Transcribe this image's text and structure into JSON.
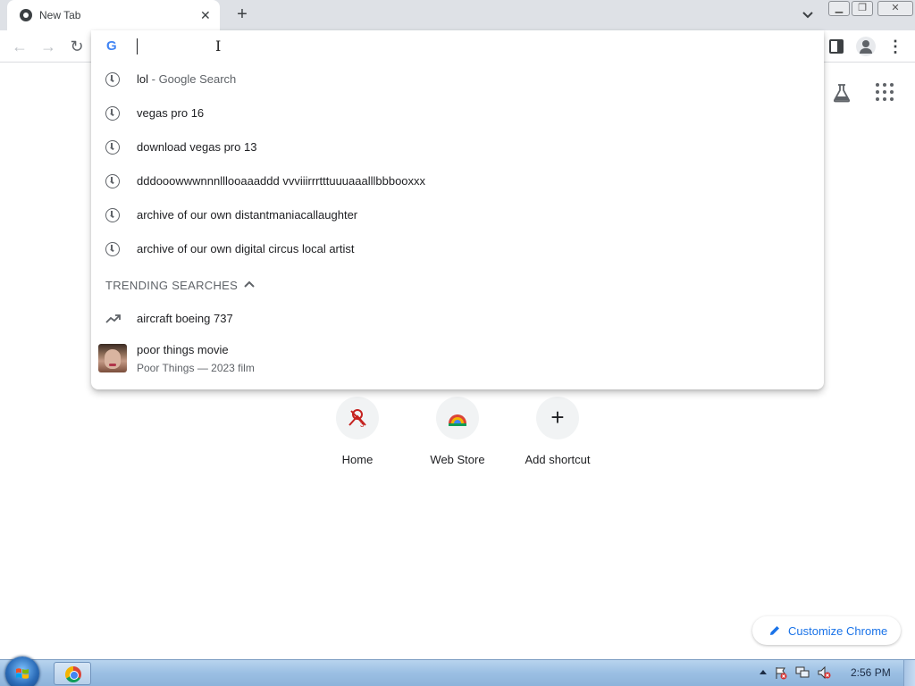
{
  "browser": {
    "tab_title": "New Tab",
    "new_tab_symbol": "+",
    "close_symbol": "✕"
  },
  "toolbar": {
    "back_symbol": "←",
    "forward_symbol": "→",
    "reload_symbol": "↻",
    "menu_symbol": "⋮"
  },
  "omnibox": {
    "input_value": "",
    "logo_letter": "G",
    "history_suggestions": [
      {
        "text": "lol",
        "sub": " - Google Search"
      },
      {
        "text": "vegas pro 16",
        "sub": ""
      },
      {
        "text": "download vegas pro 13",
        "sub": ""
      },
      {
        "text": "dddooowwwnnnlllooaaaddd vvviiirrrtttuuuaaalllbbbooxxx",
        "sub": ""
      },
      {
        "text": "archive of our own distantmaniacallaughter",
        "sub": ""
      },
      {
        "text": "archive of our own digital circus local artist",
        "sub": ""
      }
    ],
    "trending_header": "TRENDING SEARCHES",
    "trending": [
      {
        "text": "aircraft boeing 737"
      }
    ],
    "entity": {
      "title": "poor things movie",
      "subtitle": "Poor Things — 2023 film"
    }
  },
  "shortcuts": [
    {
      "label": "Home"
    },
    {
      "label": "Web Store"
    },
    {
      "label": "Add shortcut"
    }
  ],
  "customize": {
    "label": "Customize Chrome"
  },
  "taskbar": {
    "time": "2:56 PM"
  },
  "colors": {
    "accent": "#1a73e8",
    "tab_strip": "#dee1e6"
  }
}
